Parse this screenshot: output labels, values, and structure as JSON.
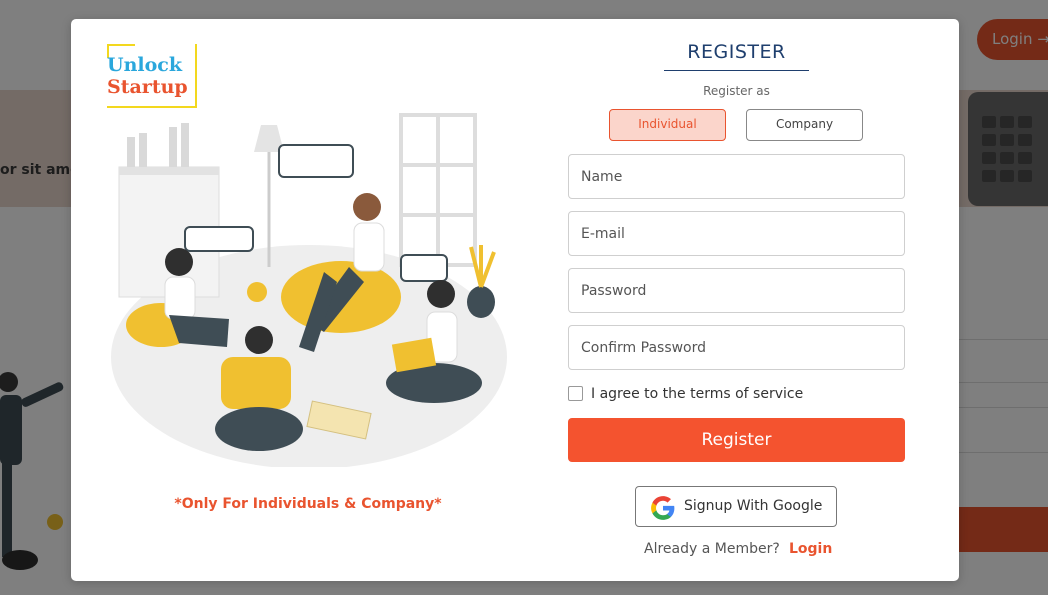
{
  "background": {
    "header_login_label": "Login",
    "banner_text": "or sit amet"
  },
  "modal": {
    "logo": {
      "line1": "Unlock",
      "line2": "Startup"
    },
    "note": "*Only For Individuals & Company*",
    "title": "REGISTER",
    "register_as_label": "Register as",
    "account_types": [
      {
        "label": "Individual",
        "selected": true
      },
      {
        "label": "Company",
        "selected": false
      }
    ],
    "fields": {
      "name_placeholder": "Name",
      "email_placeholder": "E-mail",
      "password_placeholder": "Password",
      "confirm_password_placeholder": "Confirm Password"
    },
    "agree_label": "I agree to the terms of service",
    "agree_checked": false,
    "register_button": "Register",
    "google_button": "Signup With Google",
    "member_prompt": "Already a Member?",
    "login_link": "Login"
  },
  "colors": {
    "accent": "#f4532f",
    "title": "#1f3f6e",
    "logo_blue": "#2aa7dc",
    "logo_yellow": "#f3d81e"
  }
}
